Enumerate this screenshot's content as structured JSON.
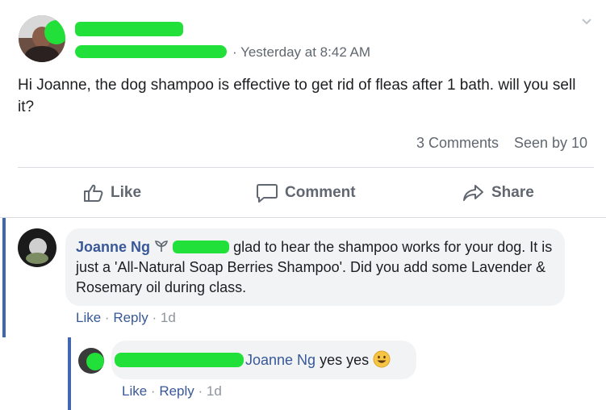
{
  "post": {
    "timestamp": "Yesterday at 8:42 AM",
    "text": "Hi Joanne, the dog shampoo is effective to get rid of fleas after 1 bath. will you sell it?",
    "comments_count": "3 Comments",
    "seen_by": "Seen by 10"
  },
  "actions": {
    "like": "Like",
    "comment": "Comment",
    "share": "Share"
  },
  "comments": [
    {
      "author": "Joanne Ng",
      "text": "glad to hear the shampoo works for your dog. It is just a 'All-Natural Soap Berries Shampoo'. Did you add some Lavender & Rosemary oil during class.",
      "like": "Like",
      "reply": "Reply",
      "time": "1d"
    }
  ],
  "reply": {
    "mention": "Joanne Ng",
    "text": "yes yes",
    "like": "Like",
    "reply": "Reply",
    "time": "1d"
  },
  "colors": {
    "link": "#385898",
    "redaction": "#22e03a",
    "thread_line": "#4267b2"
  }
}
